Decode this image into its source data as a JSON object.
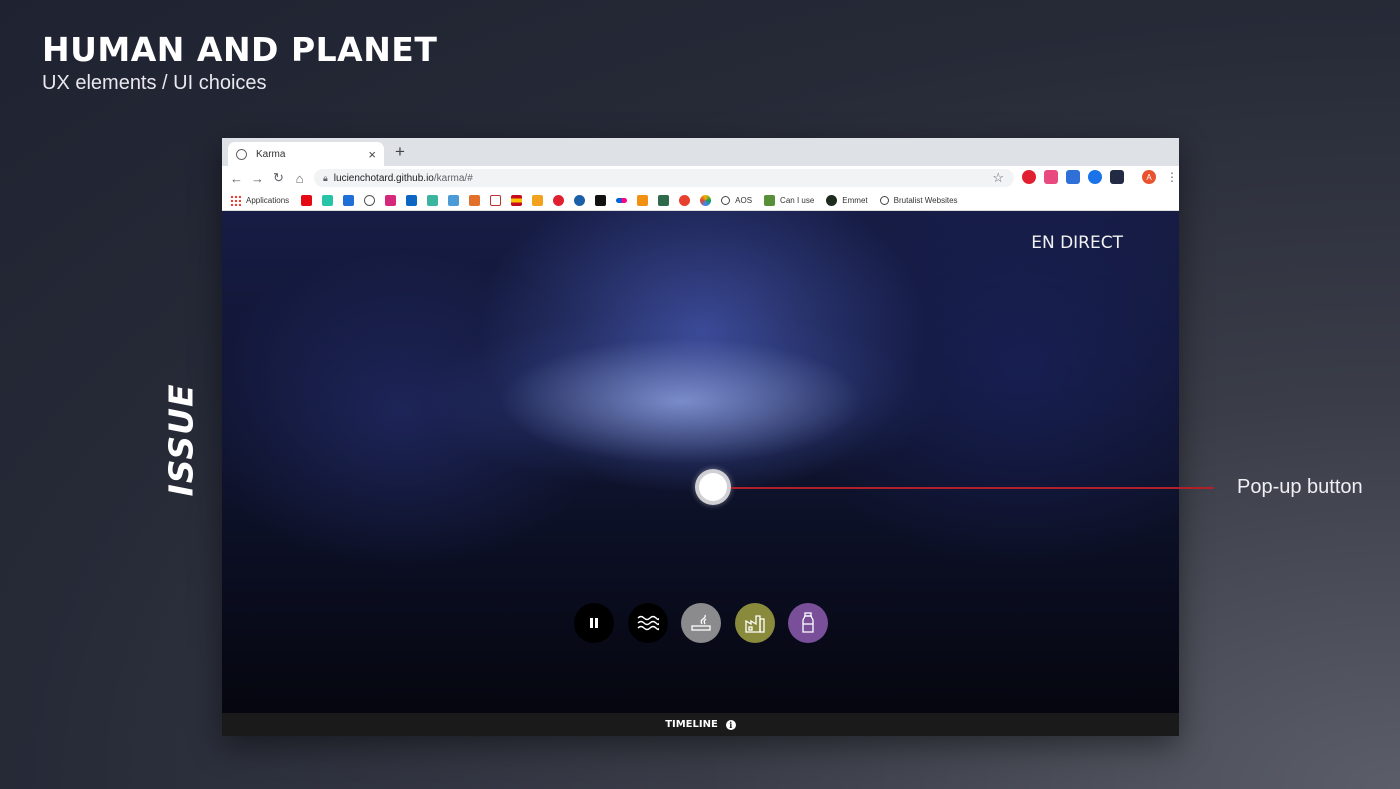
{
  "slide": {
    "title": "HUMAN AND PLANET",
    "subtitle": "UX elements / UI choices",
    "side_label": "ISSUE",
    "annotation": "Pop-up button",
    "annotation_line_color": "#b0202a"
  },
  "browser": {
    "tab_title": "Karma",
    "new_tab": "+",
    "tab_close": "×",
    "url_host": "lucienchotard.github.io",
    "url_path": "/karma/#",
    "bookmarks": [
      {
        "name": "apps",
        "label": "Applications"
      },
      {
        "name": "aos",
        "label": "AOS"
      },
      {
        "name": "caniuse",
        "label": "Can I use"
      },
      {
        "name": "emmet",
        "label": "Emmet"
      },
      {
        "name": "brutalist",
        "label": "Brutalist Websites"
      }
    ],
    "avatar_letter": "A"
  },
  "page": {
    "live_label": "EN DIRECT",
    "timeline_label": "TIMELINE",
    "info_glyph": "i",
    "controls": [
      {
        "name": "pause-button",
        "icon": "pause-icon",
        "color": "#000000"
      },
      {
        "name": "water-button",
        "icon": "waves-icon",
        "color": "#000000"
      },
      {
        "name": "pollution-button",
        "icon": "smoke-icon",
        "color": "#8b8b8d"
      },
      {
        "name": "industry-button",
        "icon": "factory-icon",
        "color": "#8a8a3c"
      },
      {
        "name": "plastic-button",
        "icon": "bottle-icon",
        "color": "#7a4f9a"
      }
    ]
  }
}
